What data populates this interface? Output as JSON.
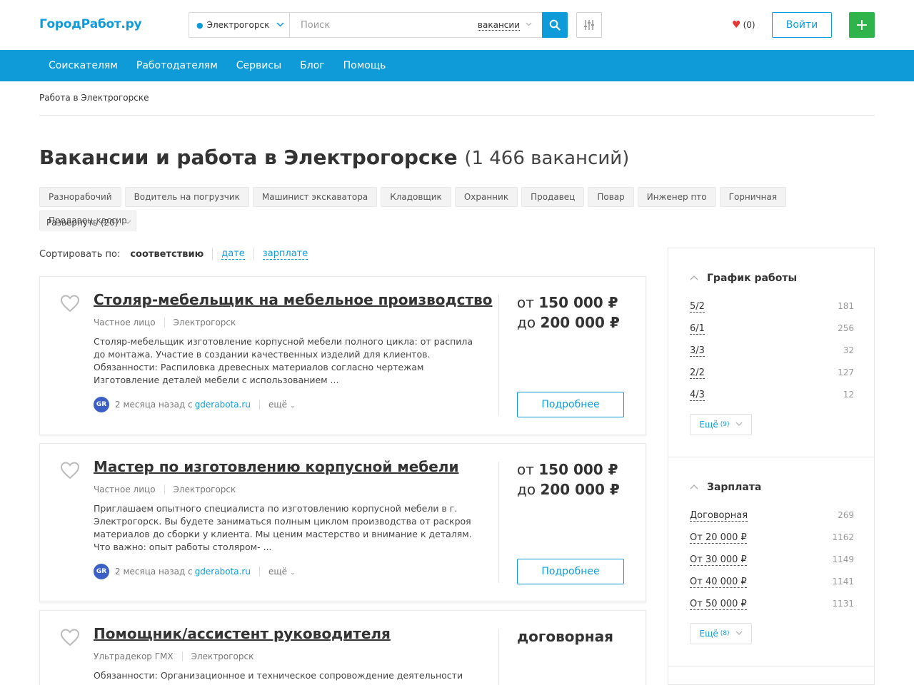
{
  "header": {
    "logo": "ГородРабот.ру",
    "city": "Электрогорск",
    "search_placeholder": "Поиск",
    "search_type": "вакансии",
    "favorites_count": "(0)",
    "login_label": "Войти",
    "add_label": "+"
  },
  "nav": {
    "items": [
      "Соискателям",
      "Работодателям",
      "Сервисы",
      "Блог",
      "Помощь"
    ]
  },
  "breadcrumb": "Работа в Электрогорске",
  "page": {
    "title": "Вакансии и работа в Электрогорске",
    "count": "(1 466 вакансий)"
  },
  "chips": [
    "Разнорабочий",
    "Водитель на погрузчик",
    "Машинист экскаватора",
    "Кладовщик",
    "Охранник",
    "Продавец",
    "Повар",
    "Инженер пто",
    "Горничная",
    "Продавец-кассир"
  ],
  "expand_label": "Развернуть (20)",
  "sort": {
    "label": "Сортировать по:",
    "active": "соответствию",
    "date": "дате",
    "salary": "зарплате"
  },
  "vacancies": [
    {
      "title": "Столяр-мебельщик на мебельное производство",
      "employer": "Частное лицо",
      "city": "Электрогорск",
      "description": "Столяр-мебельщик изготовление корпусной мебели полного цикла: от распила до монтажа. Участие в создании качественных изделий для клиентов. Обязанности: Распиловка древесных материалов согласно чертежам Изготовление деталей мебели с использованием ...",
      "posted": "2 месяца назад с",
      "source_site": "gderabota.ru",
      "more": "ещё",
      "salary_from_prefix": "от",
      "salary_from": "150 000 ₽",
      "salary_to_prefix": "до",
      "salary_to": "200 000 ₽",
      "details_label": "Подробнее"
    },
    {
      "title": "Мастер по изготовлению корпусной мебели",
      "employer": "Частное лицо",
      "city": "Электрогорск",
      "description": "Приглашаем опытного специалиста по изготовлению корпусной мебели в г. Электрогорск. Вы будете заниматься полным циклом производства от раскроя материалов до сборки у клиента. Мы ценим мастерство и внимание к деталям. Что важно: опыт работы столяром- ...",
      "posted": "2 месяца назад с",
      "source_site": "gderabota.ru",
      "more": "ещё",
      "salary_from_prefix": "от",
      "salary_from": "150 000 ₽",
      "salary_to_prefix": "до",
      "salary_to": "200 000 ₽",
      "details_label": "Подробнее"
    },
    {
      "title": "Помощник/ассистент руководителя",
      "employer": "Ультрадекор ГМХ",
      "city": "Электрогорск",
      "description": "Обязанности: Организационное и техническое сопровождение деятельности",
      "salary_text": "договорная"
    }
  ],
  "sidebar": {
    "schedule": {
      "title": "График работы",
      "rows": [
        {
          "label": "5/2",
          "count": "181"
        },
        {
          "label": "6/1",
          "count": "256"
        },
        {
          "label": "3/3",
          "count": "32"
        },
        {
          "label": "2/2",
          "count": "127"
        },
        {
          "label": "4/3",
          "count": "12"
        }
      ],
      "more_label": "Ещё",
      "more_count": "(9)"
    },
    "salary": {
      "title": "Зарплата",
      "rows": [
        {
          "label": "Договорная",
          "count": "269"
        },
        {
          "label": "От 20 000 ₽",
          "count": "1162"
        },
        {
          "label": "От 30 000 ₽",
          "count": "1149"
        },
        {
          "label": "От 40 000 ₽",
          "count": "1141"
        },
        {
          "label": "От 50 000 ₽",
          "count": "1131"
        }
      ],
      "more_label": "Ещё",
      "more_count": "(8)"
    }
  },
  "colors": {
    "brand": "#0f9bd7",
    "add_button": "#2fb34a",
    "favorite_heart": "#e53935"
  }
}
